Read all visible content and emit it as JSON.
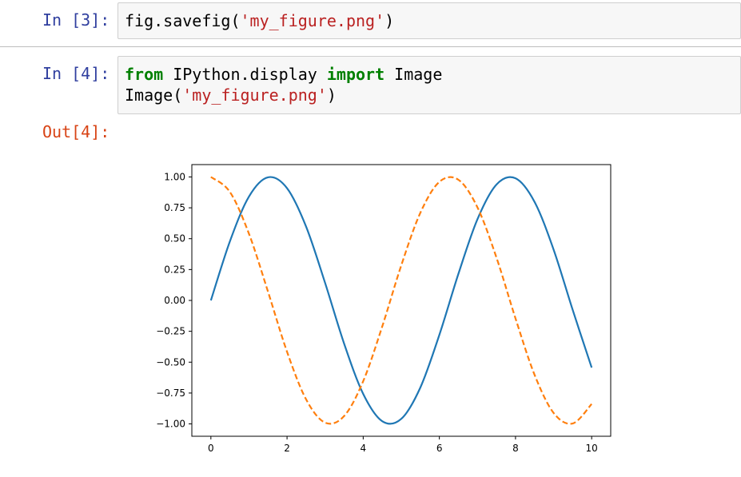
{
  "cells": [
    {
      "prompt": "In [3]:",
      "lines": [
        [
          {
            "t": "fig.savefig(",
            "c": ""
          },
          {
            "t": "'my_figure.png'",
            "c": "str"
          },
          {
            "t": ")",
            "c": ""
          }
        ]
      ]
    },
    {
      "prompt": "In [4]:",
      "lines": [
        [
          {
            "t": "from",
            "c": "kw"
          },
          {
            "t": " IPython.display ",
            "c": ""
          },
          {
            "t": "import",
            "c": "kw"
          },
          {
            "t": " Image",
            "c": ""
          }
        ],
        [
          {
            "t": "Image(",
            "c": ""
          },
          {
            "t": "'my_figure.png'",
            "c": "str"
          },
          {
            "t": ")",
            "c": ""
          }
        ]
      ]
    }
  ],
  "output_prompt": "Out[4]:",
  "colors": {
    "series_sin": "#1f77b4",
    "series_cos": "#ff7f0e",
    "prompt_in": "#303f9f",
    "prompt_out": "#d84315"
  },
  "chart_data": {
    "type": "line",
    "title": "",
    "xlabel": "",
    "ylabel": "",
    "xlim": [
      -0.5,
      10.5
    ],
    "ylim": [
      -1.1,
      1.1
    ],
    "xticks": [
      0,
      2,
      4,
      6,
      8,
      10
    ],
    "yticks": [
      1.0,
      0.75,
      0.5,
      0.25,
      0.0,
      -0.25,
      -0.5,
      -0.75,
      -1.0
    ],
    "ytick_labels": [
      "1.00",
      "0.75",
      "0.50",
      "0.25",
      "0.00",
      "−0.25",
      "−0.50",
      "−0.75",
      "−1.00"
    ],
    "xtick_labels": [
      "0",
      "2",
      "4",
      "6",
      "8",
      "10"
    ],
    "grid": false,
    "legend": false,
    "series": [
      {
        "style": "solid",
        "color": "#1f77b4",
        "x": [
          0,
          0.5,
          1,
          1.5,
          2,
          2.5,
          3,
          3.5,
          4,
          4.5,
          5,
          5.5,
          6,
          6.5,
          7,
          7.5,
          8,
          8.5,
          9,
          9.5,
          10
        ],
        "y": [
          0,
          0.479,
          0.841,
          0.997,
          0.909,
          0.598,
          0.141,
          -0.351,
          -0.757,
          -0.978,
          -0.959,
          -0.706,
          -0.279,
          0.215,
          0.657,
          0.938,
          0.989,
          0.798,
          0.412,
          -0.075,
          -0.544
        ]
      },
      {
        "style": "dashed",
        "color": "#ff7f0e",
        "x": [
          0,
          0.5,
          1,
          1.5,
          2,
          2.5,
          3,
          3.5,
          4,
          4.5,
          5,
          5.5,
          6,
          6.5,
          7,
          7.5,
          8,
          8.5,
          9,
          9.5,
          10
        ],
        "y": [
          1,
          0.878,
          0.54,
          0.071,
          -0.416,
          -0.801,
          -0.99,
          -0.936,
          -0.654,
          -0.211,
          0.284,
          0.709,
          0.96,
          0.977,
          0.754,
          0.347,
          -0.146,
          -0.602,
          -0.911,
          -0.997,
          -0.839
        ]
      }
    ]
  }
}
